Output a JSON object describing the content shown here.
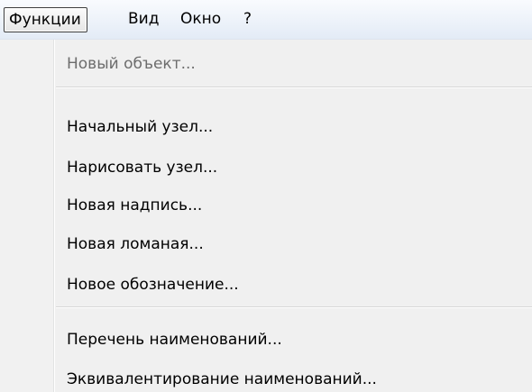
{
  "menubar": {
    "items": [
      {
        "label": "Функции",
        "active": true
      },
      {
        "label": "Вид",
        "active": false
      },
      {
        "label": "Окно",
        "active": false
      },
      {
        "label": "?",
        "active": false
      }
    ]
  },
  "dropdown": {
    "groups": [
      {
        "items": [
          {
            "label": "Новый объект...",
            "enabled": false
          }
        ]
      },
      {
        "items": [
          {
            "label": "Начальный узел...",
            "enabled": true
          },
          {
            "label": "Нарисовать узел...",
            "enabled": true
          },
          {
            "label": "Новая надпись...",
            "enabled": true
          },
          {
            "label": "Новая ломаная...",
            "enabled": true
          },
          {
            "label": "Новое обозначение...",
            "enabled": true
          }
        ]
      },
      {
        "items": [
          {
            "label": "Перечень наименований...",
            "enabled": true
          },
          {
            "label": "Эквивалентирование наименований...",
            "enabled": true
          }
        ]
      }
    ]
  },
  "colors": {
    "menubar_gradient_top": "#f9fbfe",
    "menubar_gradient_bottom": "#e3ebf6",
    "dropdown_background": "#f0f0f0",
    "disabled_text": "#6d6d6d",
    "text": "#000000"
  }
}
